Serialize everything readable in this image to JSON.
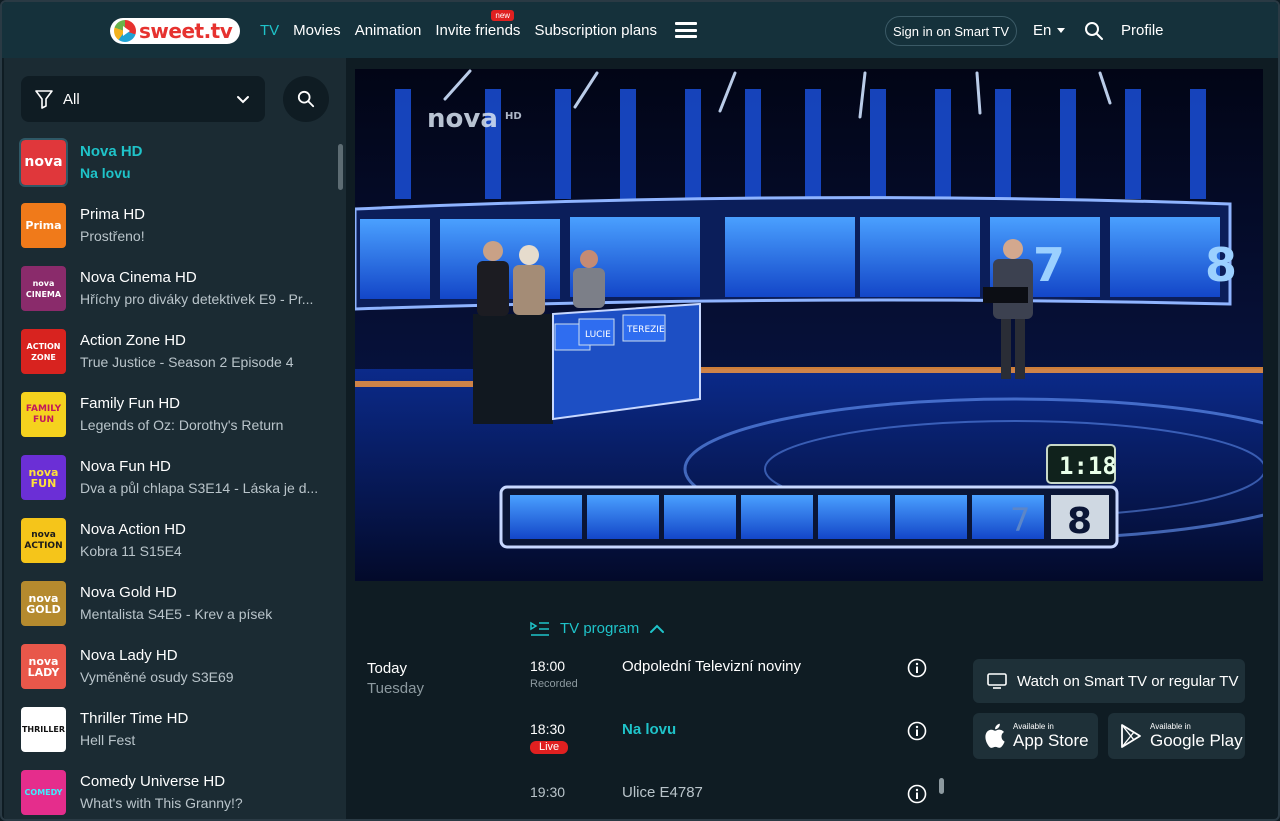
{
  "header": {
    "logo_text": "sweet.tv",
    "nav": [
      {
        "label": "TV",
        "active": true
      },
      {
        "label": "Movies"
      },
      {
        "label": "Animation"
      },
      {
        "label": "Invite friends",
        "badge": "new"
      },
      {
        "label": "Subscription plans"
      }
    ],
    "sign_in_smart_tv": "Sign in on Smart TV",
    "language": "En",
    "profile": "Profile"
  },
  "sidebar": {
    "filter_label": "All",
    "channels": [
      {
        "name": "Nova HD",
        "show": "Na lovu",
        "logo": "nova",
        "logo_color": "#e0373b",
        "active": true
      },
      {
        "name": "Prima HD",
        "show": "Prostřeno!",
        "logo": "Prima",
        "logo_color": "#f07a1a"
      },
      {
        "name": "Nova Cinema HD",
        "show": "Hříchy pro diváky detektivek E9 - Pr...",
        "logo": "nova CINEMA",
        "logo_color": "#8a2b6b"
      },
      {
        "name": "Action Zone HD",
        "show": "True Justice - Season 2 Episode 4",
        "logo": "ACTION ZONE",
        "logo_color": "#d8231f"
      },
      {
        "name": "Family Fun HD",
        "show": "Legends of Oz: Dorothy's Return",
        "logo": "FAMILY FUN",
        "logo_color": "#f5d21e"
      },
      {
        "name": "Nova Fun HD",
        "show": "Dva a půl chlapa S3E14 - Láska je d...",
        "logo": "nova FUN",
        "logo_color": "#6b2fd6"
      },
      {
        "name": "Nova Action HD",
        "show": "Kobra 11 S15E4",
        "logo": "nova ACTION",
        "logo_color": "#f5c51a"
      },
      {
        "name": "Nova Gold HD",
        "show": "Mentalista S4E5 - Krev a písek",
        "logo": "nova GOLD",
        "logo_color": "#b58a2e"
      },
      {
        "name": "Nova Lady HD",
        "show": "Vyměněné osudy S3E69",
        "logo": "nova LADY",
        "logo_color": "#e8574a"
      },
      {
        "name": "Thriller Time HD",
        "show": "Hell Fest",
        "logo": "THRILLER",
        "logo_color": "#ffffff"
      },
      {
        "name": "Comedy Universe HD",
        "show": "What's with This Granny!?",
        "logo": "COMEDY",
        "logo_color": "#e52d8c"
      }
    ]
  },
  "player": {
    "channel_watermark": "nova",
    "watermark_suffix": "HD",
    "timer": "1:18",
    "scores": [
      "7",
      "8"
    ],
    "names": [
      "LUCIE",
      "TEREZIE"
    ]
  },
  "program": {
    "toggle_label": "TV program",
    "day": "Today",
    "weekday": "Tuesday",
    "items": [
      {
        "time": "18:00",
        "status": "Recorded",
        "title": "Odpolední Televizní noviny"
      },
      {
        "time": "18:30",
        "status": "Live",
        "title": "Na lovu"
      },
      {
        "time": "19:30",
        "status": "",
        "title": "Ulice E4787"
      }
    ]
  },
  "actions": {
    "watch_smart_tv": "Watch on Smart TV or regular TV",
    "app_store_small": "Available in",
    "app_store": "App Store",
    "google_play_small": "Available in",
    "google_play": "Google Play"
  }
}
